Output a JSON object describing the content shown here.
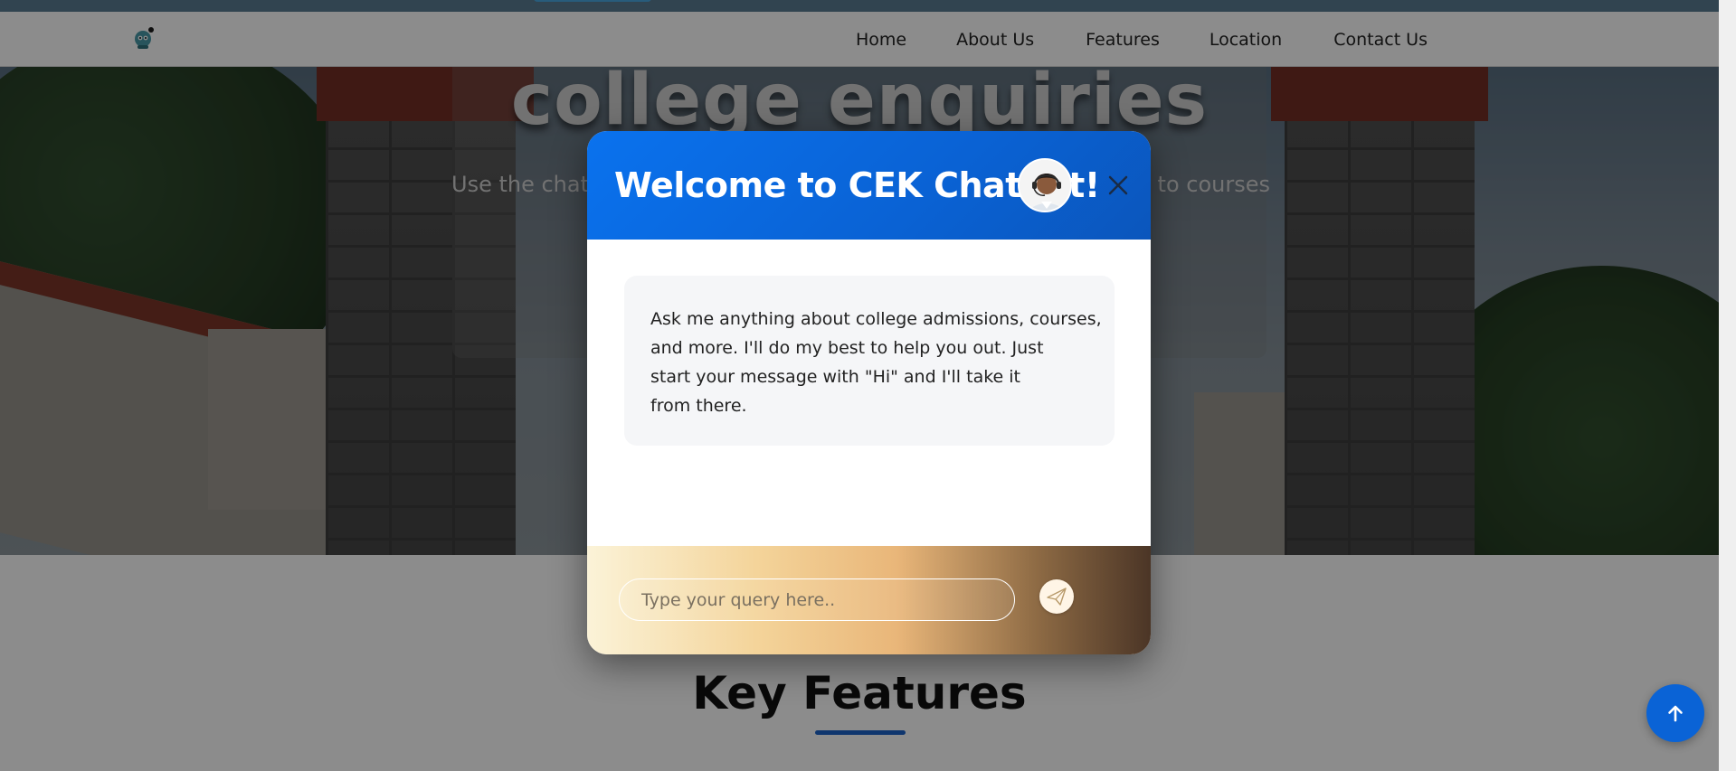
{
  "navbar": {
    "items": [
      {
        "label": "Home"
      },
      {
        "label": "About Us"
      },
      {
        "label": "Features"
      },
      {
        "label": "Location"
      },
      {
        "label": "Contact Us"
      }
    ]
  },
  "hero": {
    "title": "college enquiries",
    "subtitle_left": "Use the chatb",
    "subtitle_right": "s to courses"
  },
  "chatbot": {
    "title": "Welcome to CEK Chatbot!",
    "message_lines": [
      "Ask me anything about college admissions, courses,",
      "and more. I'll do my best to help you out. Just",
      "start your message with \"Hi\" and I'll take it",
      "from there."
    ],
    "input_placeholder": "Type your query here.."
  },
  "sections": {
    "key_features_title": "Key Features"
  },
  "colors": {
    "header_blue": "#0a72ee",
    "accent_blue": "#1d63c9",
    "scroll_top_bg": "#0a63d6"
  },
  "icons": {
    "close": "close-icon",
    "send": "paper-plane-icon",
    "scroll_top": "arrow-up-icon",
    "logo": "robot-logo-icon",
    "avatar": "support-agent-avatar"
  }
}
